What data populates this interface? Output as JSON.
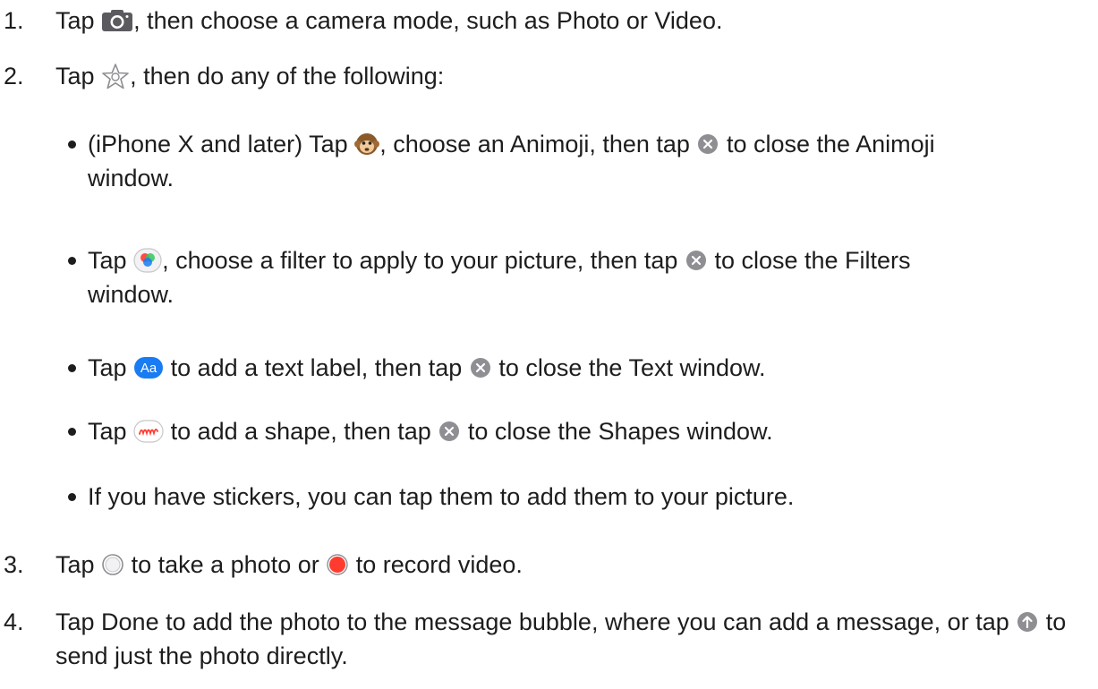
{
  "steps": [
    {
      "num": "1.",
      "t1": "Tap",
      "t2": ", then choose a camera mode, such as Photo or Video."
    },
    {
      "num": "2.",
      "t1": "Tap",
      "t2": ", then do any of the following:"
    },
    {
      "num": "3.",
      "t1": "Tap",
      "t2": "to take a photo or",
      "t3": "to record video."
    },
    {
      "num": "4.",
      "t1": "Tap Done to add the photo to the message bubble, where you can add a message, or tap",
      "t2": "to send just the photo directly."
    }
  ],
  "bullets": [
    {
      "t1": "(iPhone X and later) Tap",
      "t2": ", choose an Animoji, then tap",
      "t3": "to close the Animoji window."
    },
    {
      "t1": "Tap",
      "t2": ", choose a filter to apply to your picture, then tap",
      "t3": "to close the Filters window."
    },
    {
      "t1": "Tap",
      "t2": "to add a text label, then tap",
      "t3": "to close the Text window."
    },
    {
      "t1": "Tap",
      "t2": "to add a shape, then tap",
      "t3": "to close the Shapes window."
    },
    {
      "t1": "If you have stickers, you can tap them to add them to your picture."
    }
  ],
  "icons": {
    "camera": "camera-icon",
    "effects": "effects-star-icon",
    "animoji": "animoji-monkey-icon",
    "filters": "filters-icon",
    "text": "text-label-icon",
    "text_label": "Aa",
    "shapes": "shapes-icon",
    "close": "close-icon",
    "shutter": "shutter-icon",
    "record": "record-icon",
    "send": "send-arrow-icon"
  },
  "colors": {
    "text": "#1d1d1f",
    "accent_blue": "#1a7cf2",
    "record_red": "#ff3b30",
    "close_gray": "#8e8e93"
  }
}
